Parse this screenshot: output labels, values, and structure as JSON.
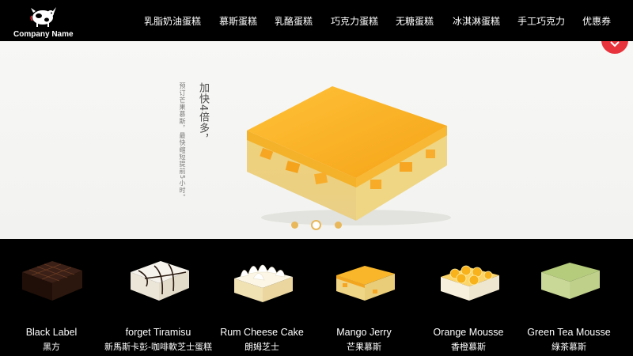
{
  "brand": {
    "name": "Company Name",
    "logo_icon": "cow-icon"
  },
  "nav": {
    "items": [
      {
        "label": "乳脂奶油蛋糕"
      },
      {
        "label": "慕斯蛋糕"
      },
      {
        "label": "乳酪蛋糕"
      },
      {
        "label": "巧克力蛋糕"
      },
      {
        "label": "无糖蛋糕"
      },
      {
        "label": "冰淇淋蛋糕"
      },
      {
        "label": "手工巧克力"
      },
      {
        "label": "优惠券"
      }
    ]
  },
  "hero": {
    "headline": "加快4倍多，",
    "subline": "预订芒果慕斯，最快缩短提前5小时。",
    "slides_total": 3,
    "active_slide": 2,
    "fav_icon": "chevron-down-icon",
    "accent_color": "#e8333d",
    "dot_color": "#e8b85a"
  },
  "products": [
    {
      "name_en": "Black Label",
      "name_cn": "黑方"
    },
    {
      "name_en": "forget Tiramisu",
      "name_cn": "新馬斯卡彭-咖啡軟芝士蛋糕"
    },
    {
      "name_en": "Rum Cheese Cake",
      "name_cn": "朗姆芝士"
    },
    {
      "name_en": "Mango Jerry",
      "name_cn": "芒果慕斯"
    },
    {
      "name_en": "Orange Mousse",
      "name_cn": "香橙慕斯"
    },
    {
      "name_en": "Green Tea Mousse",
      "name_cn": "綠茶慕斯"
    }
  ]
}
